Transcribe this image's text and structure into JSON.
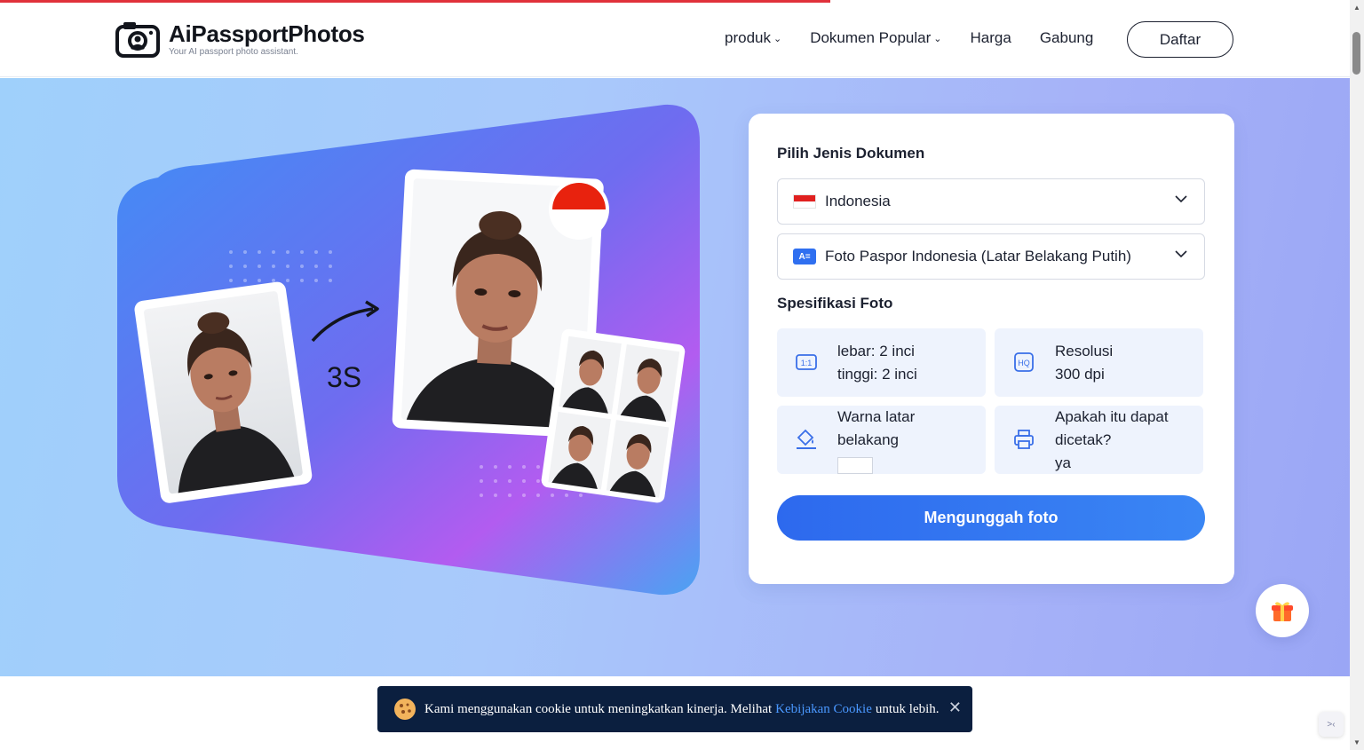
{
  "header": {
    "brand": "AiPassportPhotos",
    "tagline": "Your AI passport photo assistant.",
    "nav": [
      "produk",
      "Dokumen Popular",
      "Harga",
      "Gabung"
    ],
    "signup": "Daftar"
  },
  "hero": {
    "timer_label": "3S"
  },
  "form": {
    "section_title": "Pilih Jenis Dokumen",
    "country": "Indonesia",
    "document": "Foto Paspor Indonesia (Latar Belakang Putih)",
    "spec_title": "Spesifikasi Foto",
    "specs": [
      {
        "line1": "lebar: 2 inci",
        "line2": "tinggi: 2 inci"
      },
      {
        "line1": "Resolusi",
        "line2": "300 dpi"
      },
      {
        "line1": "Warna latar",
        "line2": "belakang",
        "swatch_color": "#ffffff"
      },
      {
        "line1": "Apakah itu dapat",
        "line2": "dicetak?",
        "line3": "ya"
      }
    ],
    "upload": "Mengunggah foto"
  },
  "cookie": {
    "text": "Kami menggunakan cookie untuk meningkatkan kinerja. Melihat",
    "link": "Kebijakan Cookie",
    "suffix": "untuk lebih.",
    "close": "✕"
  },
  "colors": {
    "accent": "#2d69ee",
    "banner_bg": "#0b1f3f"
  }
}
